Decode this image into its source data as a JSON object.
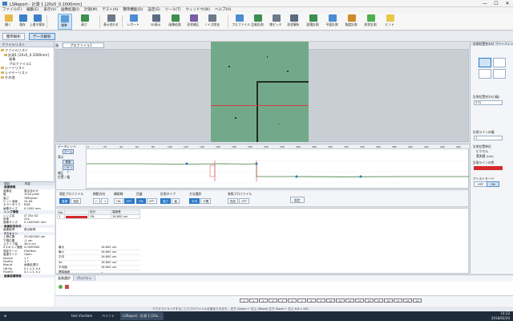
{
  "window": {
    "title": "LSReport - 計測 1 [20x5_0.1000mm]",
    "controls": [
      "—",
      "☐",
      "✕"
    ]
  },
  "menu": [
    "ファイル(F)",
    "編集(E)",
    "表示(V)",
    "画像処理(I)",
    "計測(M)",
    "テスト(A)",
    "簡単機能(D)",
    "設定(S)",
    "ツール(T)",
    "ウィンドウ(W)",
    "ヘルプ(H)"
  ],
  "ribbon": [
    {
      "label": "開く",
      "color": "#e7b94a"
    },
    {
      "label": "保存",
      "color": "#3d7fc8"
    },
    {
      "label": "上書き保存",
      "color": "#3d7fc8"
    },
    {
      "label": "標準",
      "color": "#5b9bd5"
    },
    {
      "label": "高さ",
      "color": "#3e8e4e"
    },
    {
      "label": "表示合わせ",
      "color": "#6c7a8a"
    },
    {
      "label": "レポート",
      "color": "#4c8cd1"
    },
    {
      "label": "3D表示",
      "color": "#5b6c80"
    },
    {
      "label": "画像処理",
      "color": "#3e8e4e"
    },
    {
      "label": "形状補正",
      "color": "#7a5ca8"
    },
    {
      "label": "ノイズ除去",
      "color": "#6c7a8a"
    },
    {
      "label": "プロファイル",
      "color": "#4c8cd1"
    },
    {
      "label": "比較計測",
      "color": "#3e8e4e"
    },
    {
      "label": "線ピッチ",
      "color": "#6c7a8a"
    },
    {
      "label": "形状解析",
      "color": "#5b6c80"
    },
    {
      "label": "面積計測",
      "color": "#3e8e4e"
    },
    {
      "label": "平面計測",
      "color": "#4c8cd1"
    },
    {
      "label": "角度計測",
      "color": "#d08a2a"
    },
    {
      "label": "形状計測",
      "color": "#4fb04f"
    },
    {
      "label": "ヒント",
      "color": "#e7c84a"
    }
  ],
  "modebar": {
    "left_button": "簡単解析",
    "right_button": "データ解析"
  },
  "left_panel": {
    "header": "ファイルリスト",
    "tree": [
      "ファイルリスト",
      "計測1 [20x5_0.1000mm]",
      "画像",
      "プロファイル1",
      "シートリスト",
      "レイヤーリスト",
      "その他"
    ],
    "props_header": [
      "項目",
      "内容"
    ],
    "props": [
      {
        "k": "画像情報",
        "v": "",
        "h": true
      },
      {
        "k": "画像名",
        "v": "原点合わせ"
      },
      {
        "k": "幅",
        "v": "1024 pixel"
      },
      {
        "k": "高さ",
        "v": "768 pixel"
      },
      {
        "k": "ビット深度",
        "v": "24 bit"
      },
      {
        "k": "カラータイプ",
        "v": "RGB"
      },
      {
        "k": "画素サイズ",
        "v": "0.1000 mm"
      },
      {
        "k": "レンズ情報",
        "v": "",
        "h": true
      },
      {
        "k": "レンズ名",
        "v": "LT 20x 5Z"
      },
      {
        "k": "倍率",
        "v": "20x"
      },
      {
        "k": "画素サイズ",
        "v": "0.1000000 mm"
      },
      {
        "k": "画像取得条件",
        "v": "",
        "h": true
      },
      {
        "k": "画像取得",
        "v": "原点取得"
      },
      {
        "k": "Zスキャン",
        "v": "",
        "h": true
      },
      {
        "k": "上限位置",
        "v": "23.000000 um"
      },
      {
        "k": "下限位置",
        "v": "-5 um"
      },
      {
        "k": "ステップ幅",
        "v": "38.0 nm"
      },
      {
        "k": "Zスキャン速度",
        "v": "0.0000000"
      },
      {
        "k": "測定モード",
        "v": "FineTech"
      },
      {
        "k": "高速モード",
        "v": "Open"
      },
      {
        "k": "Search",
        "v": "1.7"
      },
      {
        "k": "FineFin",
        "v": "1.7"
      },
      {
        "k": "Result",
        "v": "画像処理中"
      },
      {
        "k": "OB Ra",
        "v": "0.1 1.3, 0.4"
      },
      {
        "k": "FineFin",
        "v": "0.1 1.3, 0.1"
      },
      {
        "k": "画像認識情報",
        "v": "",
        "h": true
      }
    ]
  },
  "doc_tabs": {
    "home": "画像",
    "active": "プロファイル1"
  },
  "profile": {
    "ruler_ticks": [
      "0",
      "20",
      "40",
      "60",
      "80",
      "100",
      "120",
      "140",
      "160",
      "180",
      "200",
      "220",
      "240",
      "260",
      "280",
      "300",
      "320",
      "340",
      "360",
      "380",
      "400",
      "420",
      "440",
      "460"
    ],
    "left_labels": [
      "データレンジ",
      "表示",
      "補正"
    ],
    "left_buttons": [
      "ズーム",
      "移動",
      "リセット"
    ],
    "pan_label": "位置 / 幅"
  },
  "controls": [
    {
      "title": "測定プロファイル",
      "buttons": [
        "直線",
        "指定"
      ],
      "on": 0
    },
    {
      "title": "移動方向",
      "buttons": [
        "← ",
        "→"
      ],
      "on": -1
    },
    {
      "title": "補助線",
      "buttons": [
        "ON",
        "OFF"
      ],
      "on": 1
    },
    {
      "title": "目盛",
      "buttons": [
        "ON",
        "OFF"
      ],
      "on": 0
    },
    {
      "title": "計測タイプ",
      "buttons": [
        "高さ",
        "幅"
      ],
      "on": 0
    },
    {
      "title": "方法選択",
      "buttons": [
        "平均",
        "中間"
      ],
      "on": 0
    },
    {
      "title": "参照プロファイル",
      "buttons": [
        "指定",
        "OFF"
      ],
      "on": -1
    }
  ],
  "apply_button": "設定",
  "table": {
    "header": [
      "No.",
      "",
      "区分",
      "高度差"
    ],
    "rows": [
      [
        "1",
        "",
        "ON",
        "16.600 um"
      ]
    ]
  },
  "stats": [
    {
      "k": "最大",
      "v": "16.600 um"
    },
    {
      "k": "最小",
      "v": "16.600 um"
    },
    {
      "k": "平均",
      "v": "16.600 um"
    },
    {
      "k": "3σ",
      "v": "16.600 um"
    },
    {
      "k": "平均値",
      "v": "16.600 um"
    },
    {
      "k": "標準偏差",
      "v": "--"
    }
  ],
  "right_panel": {
    "header": "計測位置合わせ ブリーフィング",
    "section_ref": "計測位置合わせ(幅)",
    "field1": "270",
    "section_thick": "計測ラインの幅",
    "field2": "1",
    "section_unit": "計測位置単位",
    "radio1": "ピクセル",
    "radio2": "実測値 (um)",
    "section_color": "計測ラインの色",
    "toggle_label": "アシストモード",
    "toggle_off": "OFF",
    "toggle_on": "ON",
    "color_value": "#d42a2a"
  },
  "bottom": {
    "tabs": [
      "画像選択",
      "プロパティ"
    ],
    "timeline": [
      "1",
      "2",
      "3",
      "4",
      "5",
      "6",
      "7",
      "8",
      "9",
      "10",
      "11",
      "12",
      "13",
      "14",
      "15",
      "16",
      "17",
      "18",
      "19"
    ]
  },
  "status": "マウスでドラッグすることでプロファイルを指定できます。  左下 (Zoom ← 右上 (Reset)   左下 Zoom ← 右上 8.6 x 100",
  "taskbar": {
    "items": [
      "test Vividiam",
      "ペイント",
      "LSReport - 計測 1 [20x..."
    ],
    "time": "14:33",
    "date": "2018/02/20"
  },
  "colors": {
    "accent": "#2b78c6",
    "profile_line": "#3e7d3e",
    "marker_red": "#d94040"
  }
}
